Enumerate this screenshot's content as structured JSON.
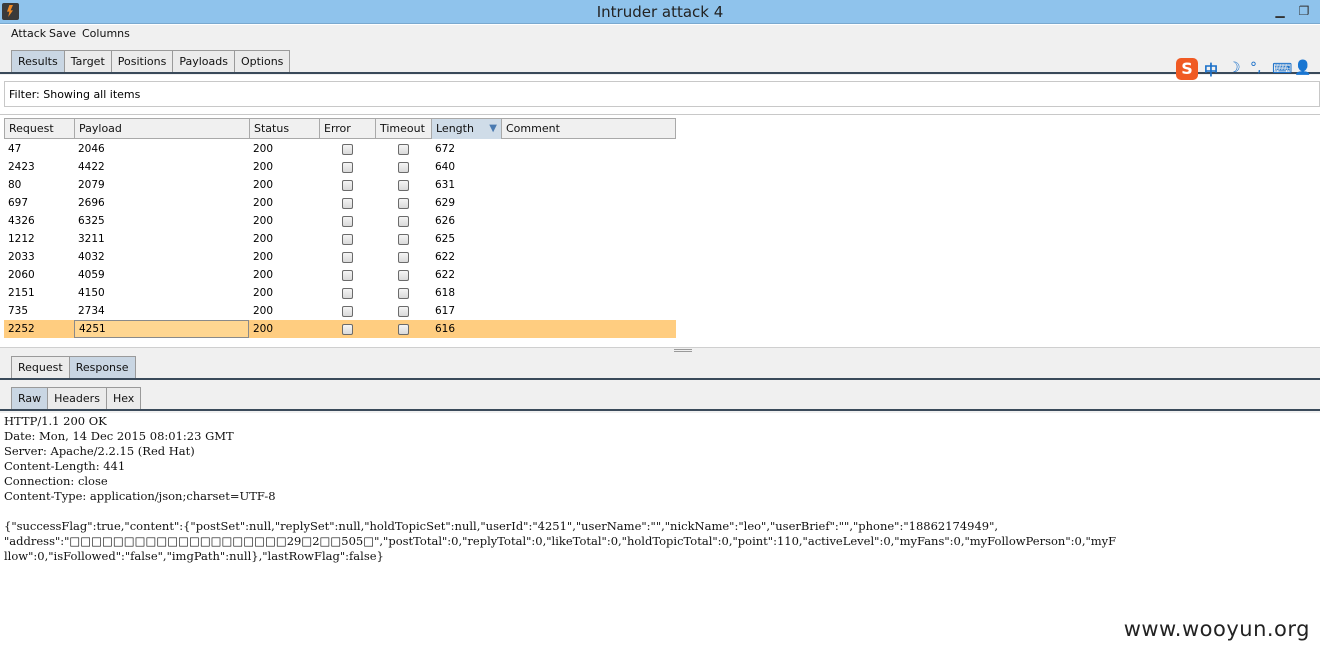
{
  "window": {
    "title": "Intruder attack 4"
  },
  "menu": [
    "Attack",
    "Save",
    "Columns"
  ],
  "main_tabs": [
    {
      "label": "Results",
      "active": true
    },
    {
      "label": "Target",
      "active": false
    },
    {
      "label": "Positions",
      "active": false
    },
    {
      "label": "Payloads",
      "active": false
    },
    {
      "label": "Options",
      "active": false
    }
  ],
  "ime": {
    "logo": "S",
    "lang": "中",
    "moon": "☽",
    "dots": "°,",
    "keyboard": "⌨",
    "person": "👤"
  },
  "filter": {
    "text": "Filter:  Showing all items"
  },
  "table": {
    "columns": [
      "Request",
      "Payload",
      "Status",
      "Error",
      "Timeout",
      "Length",
      "Comment"
    ],
    "sorted_column": "Length",
    "sort_glyph": "▼",
    "rows": [
      {
        "request": "47",
        "payload": "2046",
        "status": "200",
        "length": "672"
      },
      {
        "request": "2423",
        "payload": "4422",
        "status": "200",
        "length": "640"
      },
      {
        "request": "80",
        "payload": "2079",
        "status": "200",
        "length": "631"
      },
      {
        "request": "697",
        "payload": "2696",
        "status": "200",
        "length": "629"
      },
      {
        "request": "4326",
        "payload": "6325",
        "status": "200",
        "length": "626"
      },
      {
        "request": "1212",
        "payload": "3211",
        "status": "200",
        "length": "625"
      },
      {
        "request": "2033",
        "payload": "4032",
        "status": "200",
        "length": "622"
      },
      {
        "request": "2060",
        "payload": "4059",
        "status": "200",
        "length": "622"
      },
      {
        "request": "2151",
        "payload": "4150",
        "status": "200",
        "length": "618"
      },
      {
        "request": "735",
        "payload": "2734",
        "status": "200",
        "length": "617"
      },
      {
        "request": "2252",
        "payload": "4251",
        "status": "200",
        "length": "616",
        "selected": true
      }
    ]
  },
  "detail_tabs": [
    {
      "label": "Request",
      "active": false
    },
    {
      "label": "Response",
      "active": true
    }
  ],
  "view_tabs": [
    {
      "label": "Raw",
      "active": true
    },
    {
      "label": "Headers",
      "active": false
    },
    {
      "label": "Hex",
      "active": false
    }
  ],
  "response_lines": [
    "HTTP/1.1 200 OK",
    "Date: Mon, 14 Dec 2015 08:01:23 GMT",
    "Server: Apache/2.2.15 (Red Hat)",
    "Content-Length: 441",
    "Connection: close",
    "Content-Type: application/json;charset=UTF-8",
    "",
    "{\"successFlag\":true,\"content\":{\"postSet\":null,\"replySet\":null,\"holdTopicSet\":null,\"userId\":\"4251\",\"userName\":\"\",\"nickName\":\"leo\",\"userBrief\":\"\",\"phone\":\"18862174949\",",
    "\"address\":\"□□□□□□□□□□□□□□□□□□□□29□2□□505□\",\"postTotal\":0,\"replyTotal\":0,\"likeTotal\":0,\"holdTopicTotal\":0,\"point\":110,\"activeLevel\":0,\"myFans\":0,\"myFollowPerson\":0,\"myF",
    "llow\":0,\"isFollowed\":\"false\",\"imgPath\":null},\"lastRowFlag\":false}"
  ],
  "watermark": "www.wooyun.org"
}
